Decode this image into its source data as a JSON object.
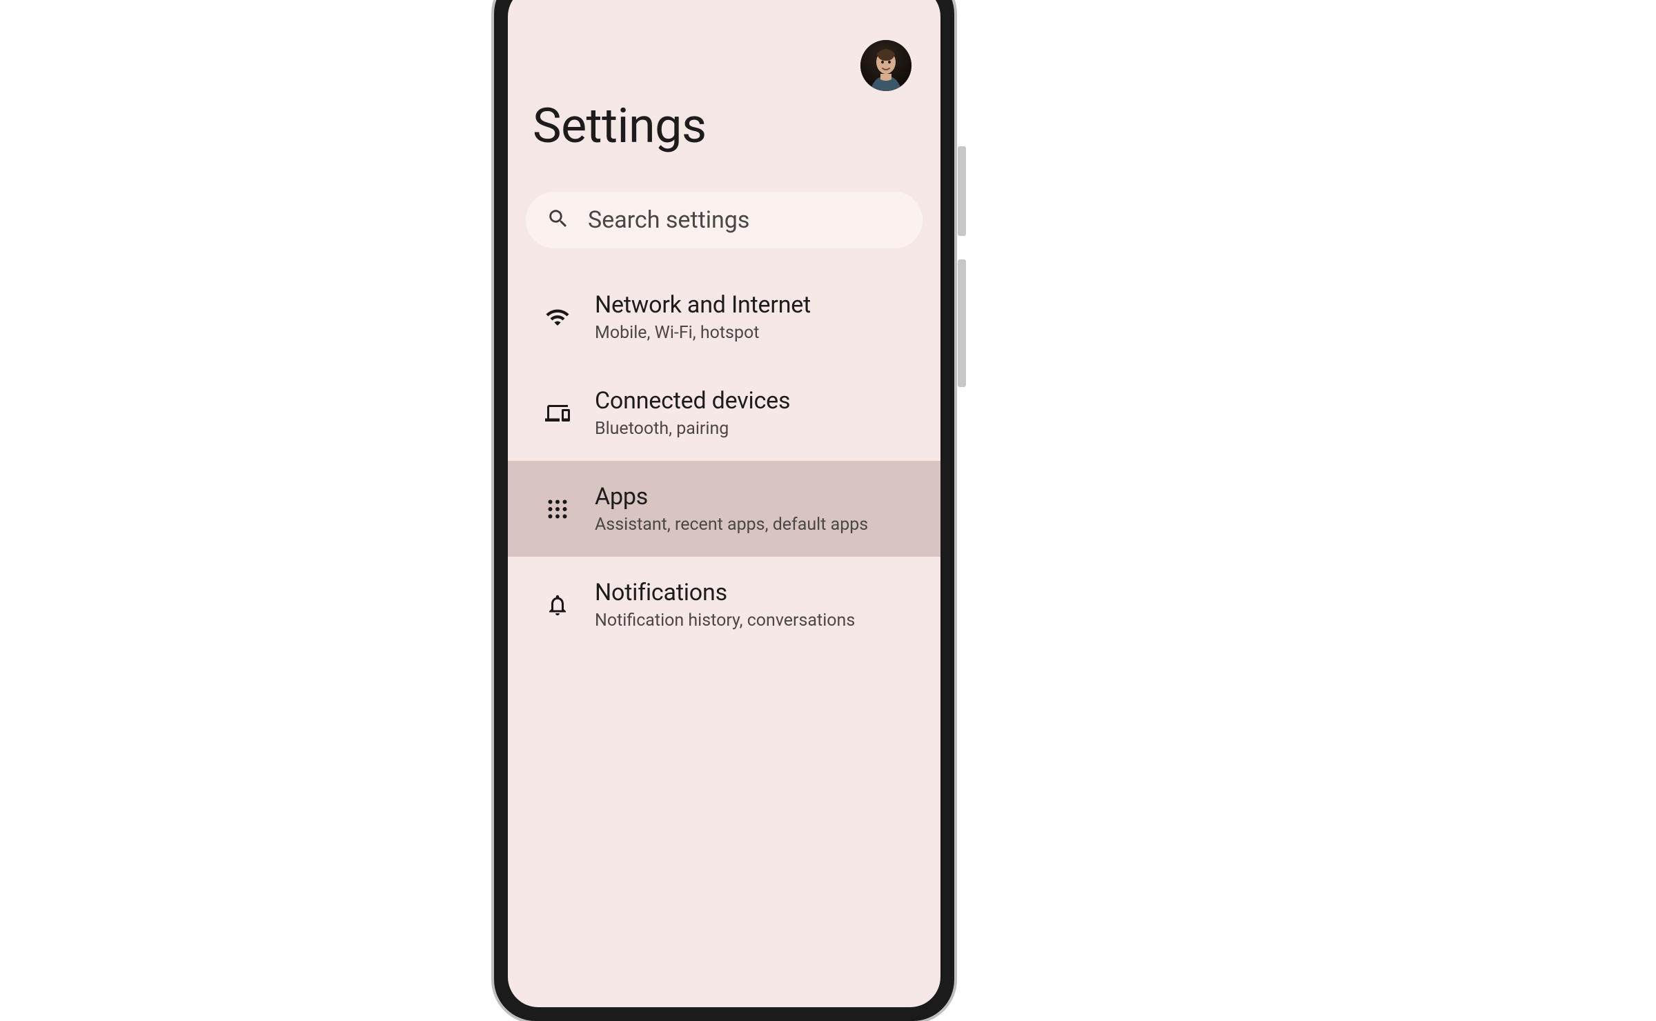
{
  "header": {
    "title": "Settings"
  },
  "search": {
    "placeholder": "Search settings"
  },
  "items": [
    {
      "icon": "wifi-icon",
      "title": "Network and Internet",
      "subtitle": "Mobile, Wi-Fi, hotspot",
      "highlighted": false
    },
    {
      "icon": "devices-icon",
      "title": "Connected devices",
      "subtitle": "Bluetooth, pairing",
      "highlighted": false
    },
    {
      "icon": "apps-icon",
      "title": "Apps",
      "subtitle": "Assistant, recent apps, default apps",
      "highlighted": true
    },
    {
      "icon": "notifications-icon",
      "title": "Notifications",
      "subtitle": "Notification history, conversations",
      "highlighted": false
    }
  ]
}
